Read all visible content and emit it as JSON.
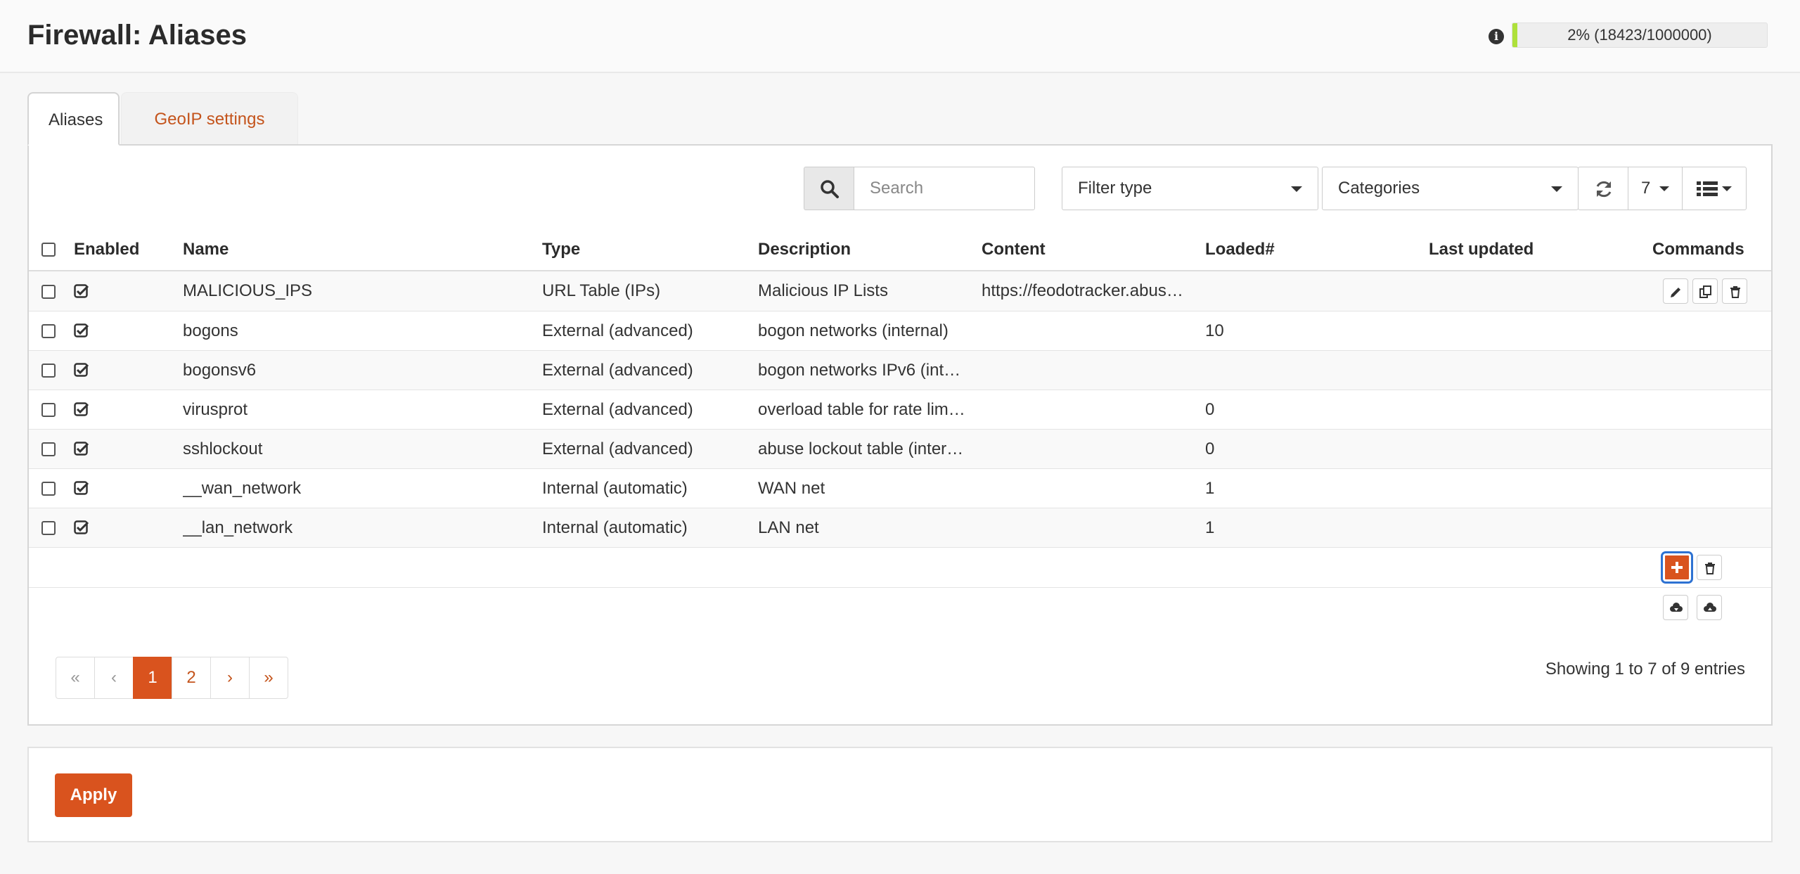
{
  "header": {
    "title": "Firewall: Aliases",
    "progress_text": "2% (18423/1000000)",
    "progress_percent": 2
  },
  "tabs": [
    {
      "label": "Aliases",
      "active": true
    },
    {
      "label": "GeoIP settings",
      "active": false
    }
  ],
  "toolbar": {
    "search_placeholder": "Search",
    "filter_type_label": "Filter type",
    "categories_label": "Categories",
    "page_size": "7"
  },
  "table": {
    "columns": [
      "Enabled",
      "Name",
      "Type",
      "Description",
      "Content",
      "Loaded#",
      "Last updated",
      "Commands"
    ],
    "rows": [
      {
        "name": "MALICIOUS_IPS",
        "type": "URL Table (IPs)",
        "description": "Malicious IP Lists",
        "content": "https://feodotracker.abus…",
        "loaded": "",
        "last_updated": ""
      },
      {
        "name": "bogons",
        "type": "External (advanced)",
        "description": "bogon networks (internal)",
        "content": "",
        "loaded": "10",
        "last_updated": ""
      },
      {
        "name": "bogonsv6",
        "type": "External (advanced)",
        "description": "bogon networks IPv6 (int…",
        "content": "",
        "loaded": "",
        "last_updated": ""
      },
      {
        "name": "virusprot",
        "type": "External (advanced)",
        "description": "overload table for rate lim…",
        "content": "",
        "loaded": "0",
        "last_updated": ""
      },
      {
        "name": "sshlockout",
        "type": "External (advanced)",
        "description": "abuse lockout table (inter…",
        "content": "",
        "loaded": "0",
        "last_updated": ""
      },
      {
        "name": "__wan_network",
        "type": "Internal (automatic)",
        "description": "WAN net",
        "content": "",
        "loaded": "1",
        "last_updated": ""
      },
      {
        "name": "__lan_network",
        "type": "Internal (automatic)",
        "description": "LAN net",
        "content": "",
        "loaded": "1",
        "last_updated": ""
      }
    ]
  },
  "pagination": {
    "first": "«",
    "prev": "‹",
    "pages": [
      "1",
      "2"
    ],
    "next": "›",
    "last": "»",
    "current": "1"
  },
  "footer": {
    "entries_text": "Showing 1 to 7 of 9 entries",
    "apply_label": "Apply"
  },
  "colors": {
    "accent": "#d9531e",
    "progress": "#aee13b",
    "focus_ring": "#2e72d2"
  }
}
